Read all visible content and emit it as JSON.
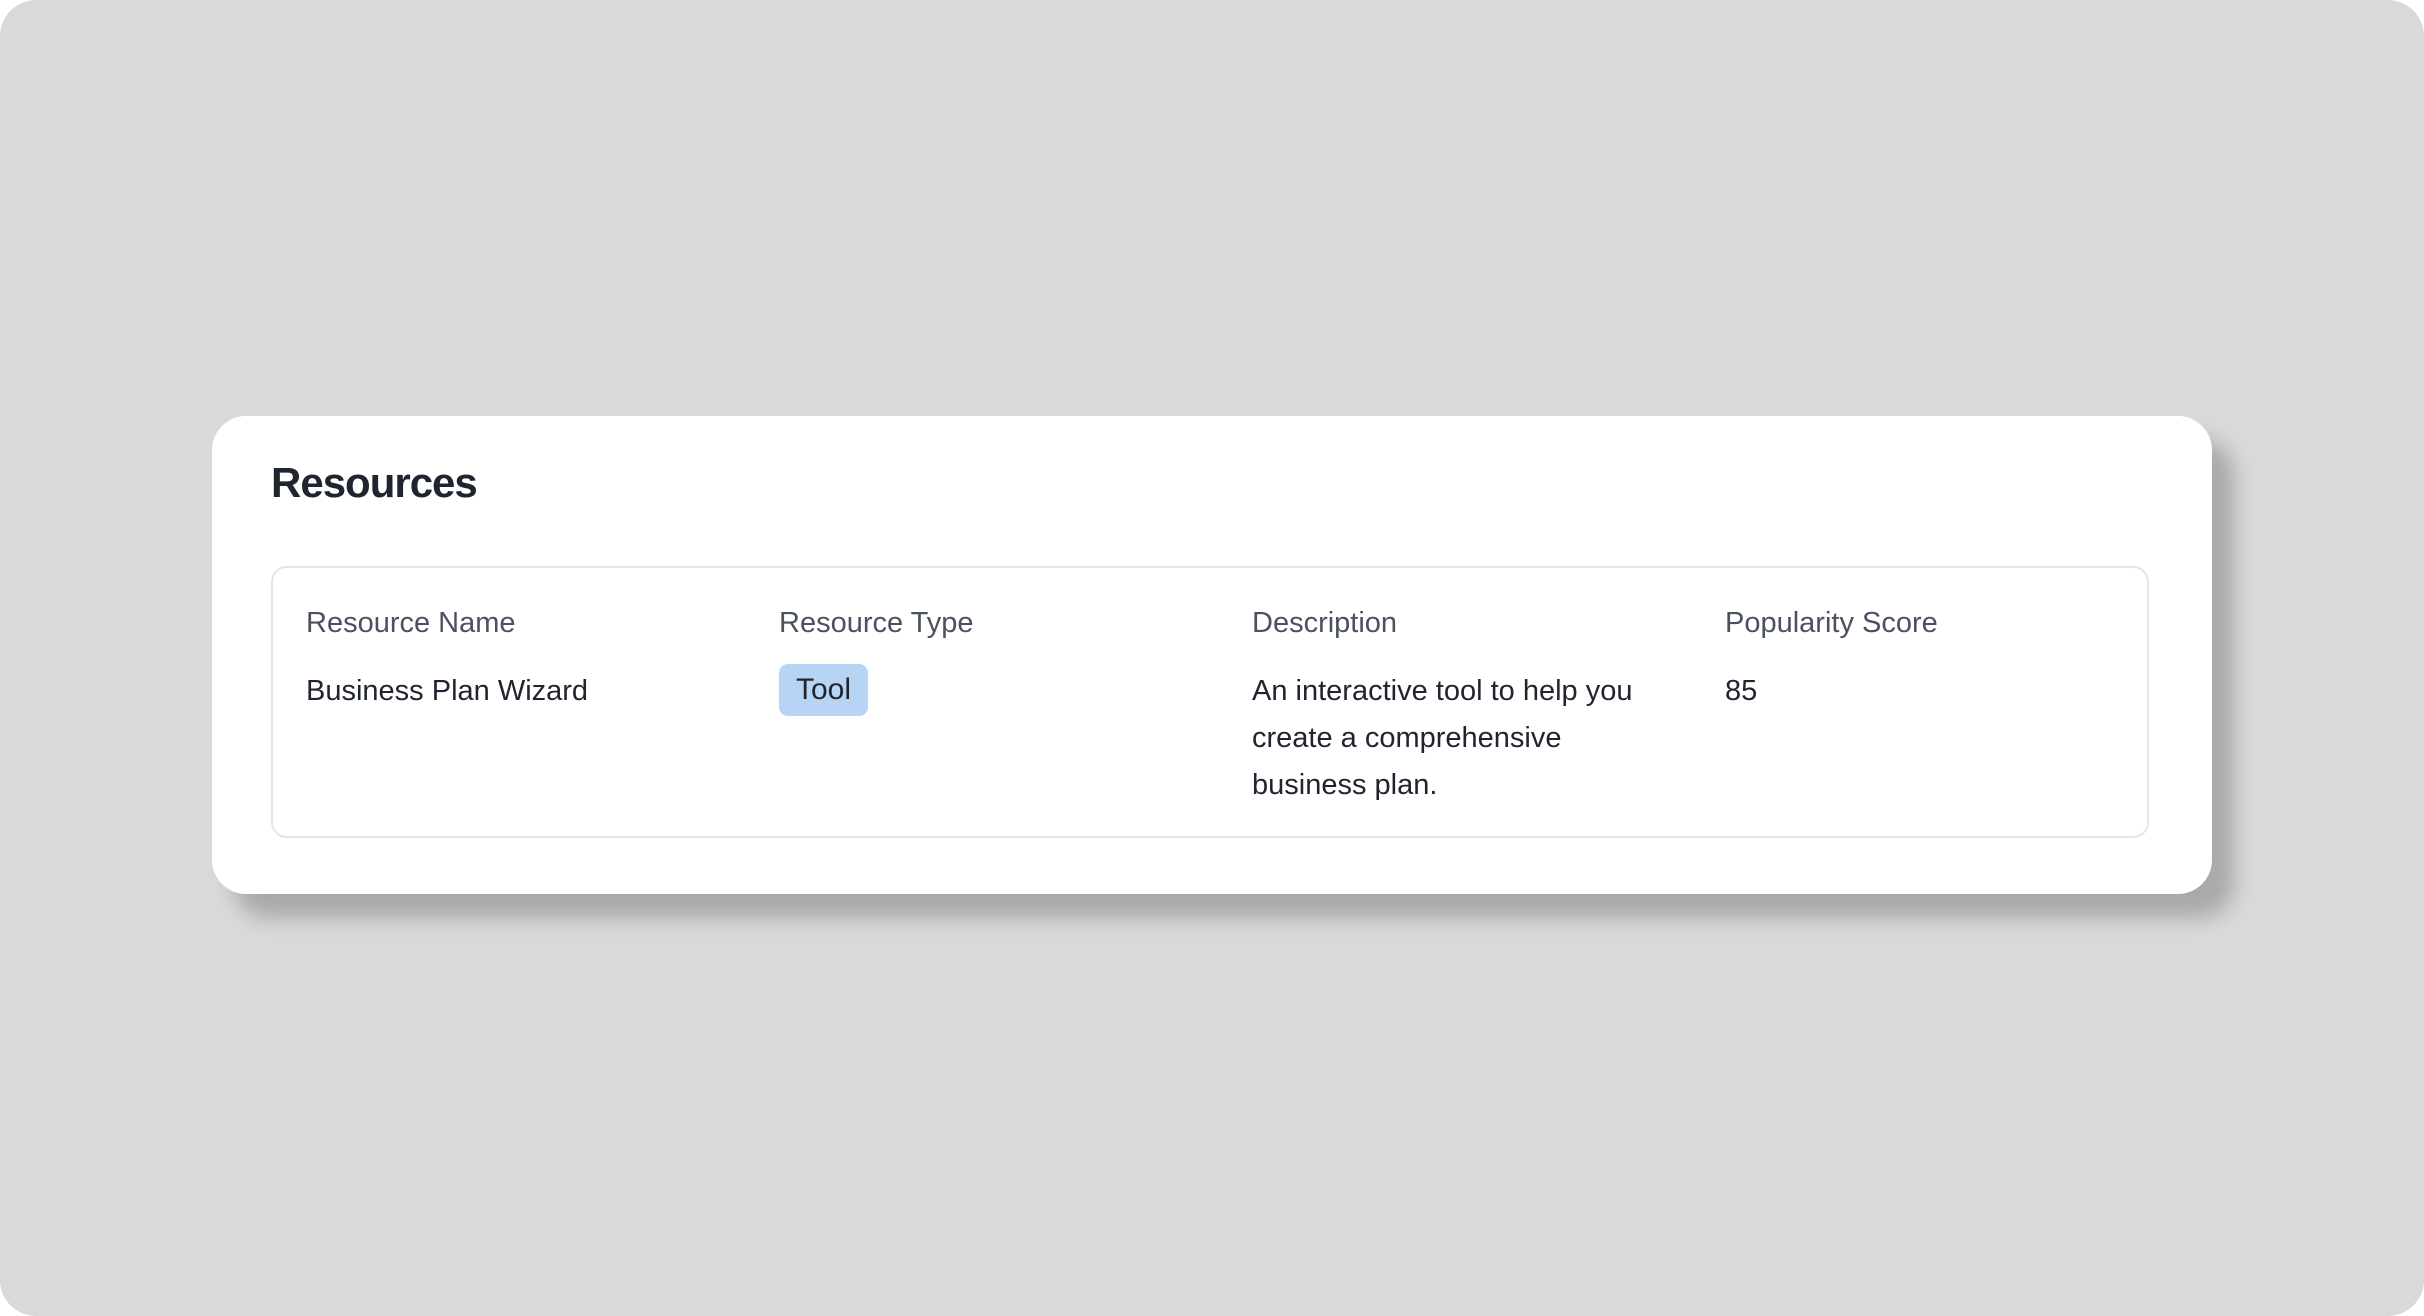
{
  "page": {
    "title": "Resources"
  },
  "table": {
    "headers": [
      "Resource Name",
      "Resource Type",
      "Description",
      "Popularity Score"
    ],
    "rows": [
      {
        "resource_name": "Business Plan Wizard",
        "resource_type": "Tool",
        "description": "An interactive tool to help you create a comprehensive business plan.",
        "popularity_score": "85"
      }
    ]
  },
  "colors": {
    "backdrop": "#d9d9d9",
    "card": "#ffffff",
    "badge_background": "#b7d4f4",
    "text_primary": "#1f2430",
    "text_header": "#4b5160",
    "table_border": "#e3e5e8"
  }
}
